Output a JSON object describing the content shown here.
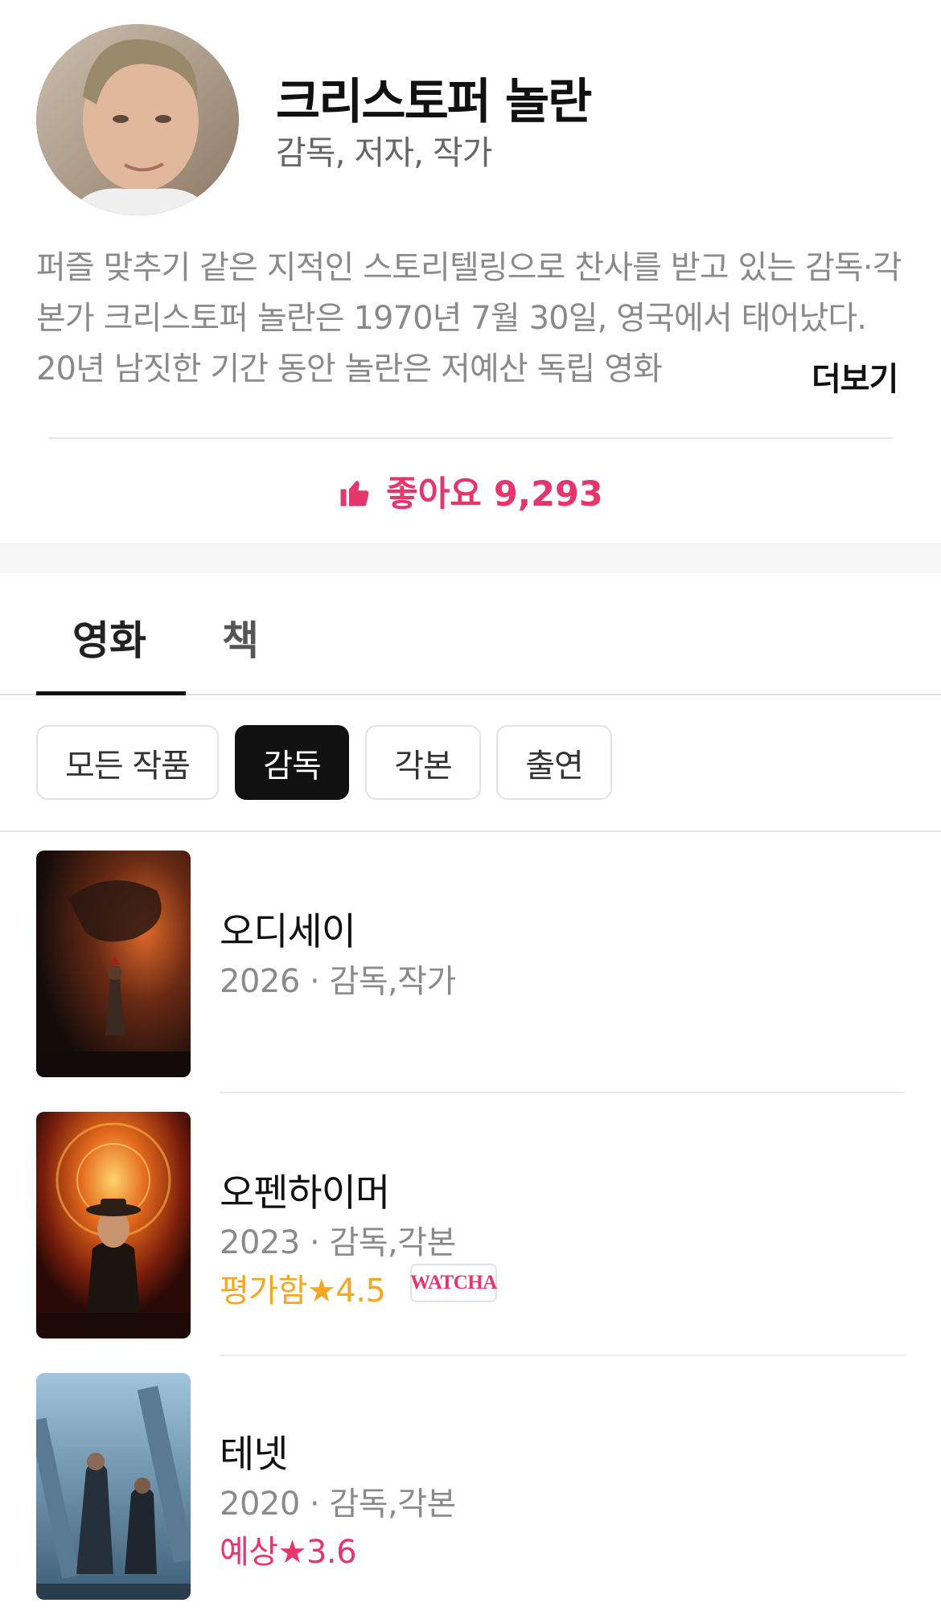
{
  "profile": {
    "name": "크리스토퍼 놀란",
    "roles": "감독, 저자, 작가",
    "bio": "퍼즐 맞추기 같은 지적인 스토리텔링으로 찬사를 받고 있는 감독·각본가 크리스토퍼 놀란은 1970년 7월 30일, 영국에서 태어났다. 20년 남짓한 기간 동안 놀란은 저예산 독립 영화",
    "more_label": "더보기",
    "like_label": "좋아요",
    "like_count": "9,293"
  },
  "tabs": [
    {
      "label": "영화"
    },
    {
      "label": "책"
    }
  ],
  "filters": [
    {
      "label": "모든 작품"
    },
    {
      "label": "감독"
    },
    {
      "label": "각본"
    },
    {
      "label": "출연"
    }
  ],
  "movies": [
    {
      "title": "오디세이",
      "meta": "2026 · 감독,작가",
      "rating_label": "",
      "rating_value": "",
      "badge": ""
    },
    {
      "title": "오펜하이머",
      "meta": "2023 · 감독,각본",
      "rating_label": "평가함",
      "rating_value": "4.5",
      "badge": "WATCHA"
    },
    {
      "title": "테넷",
      "meta": "2020 · 감독,각본",
      "rating_label": "예상",
      "rating_value": "3.6",
      "badge": ""
    }
  ],
  "colors": {
    "accent": "#e5356a",
    "rated": "#f5a623",
    "muted": "#8a8a8a"
  },
  "icons": {
    "like": "thumbs-up-icon",
    "star": "star-icon"
  }
}
